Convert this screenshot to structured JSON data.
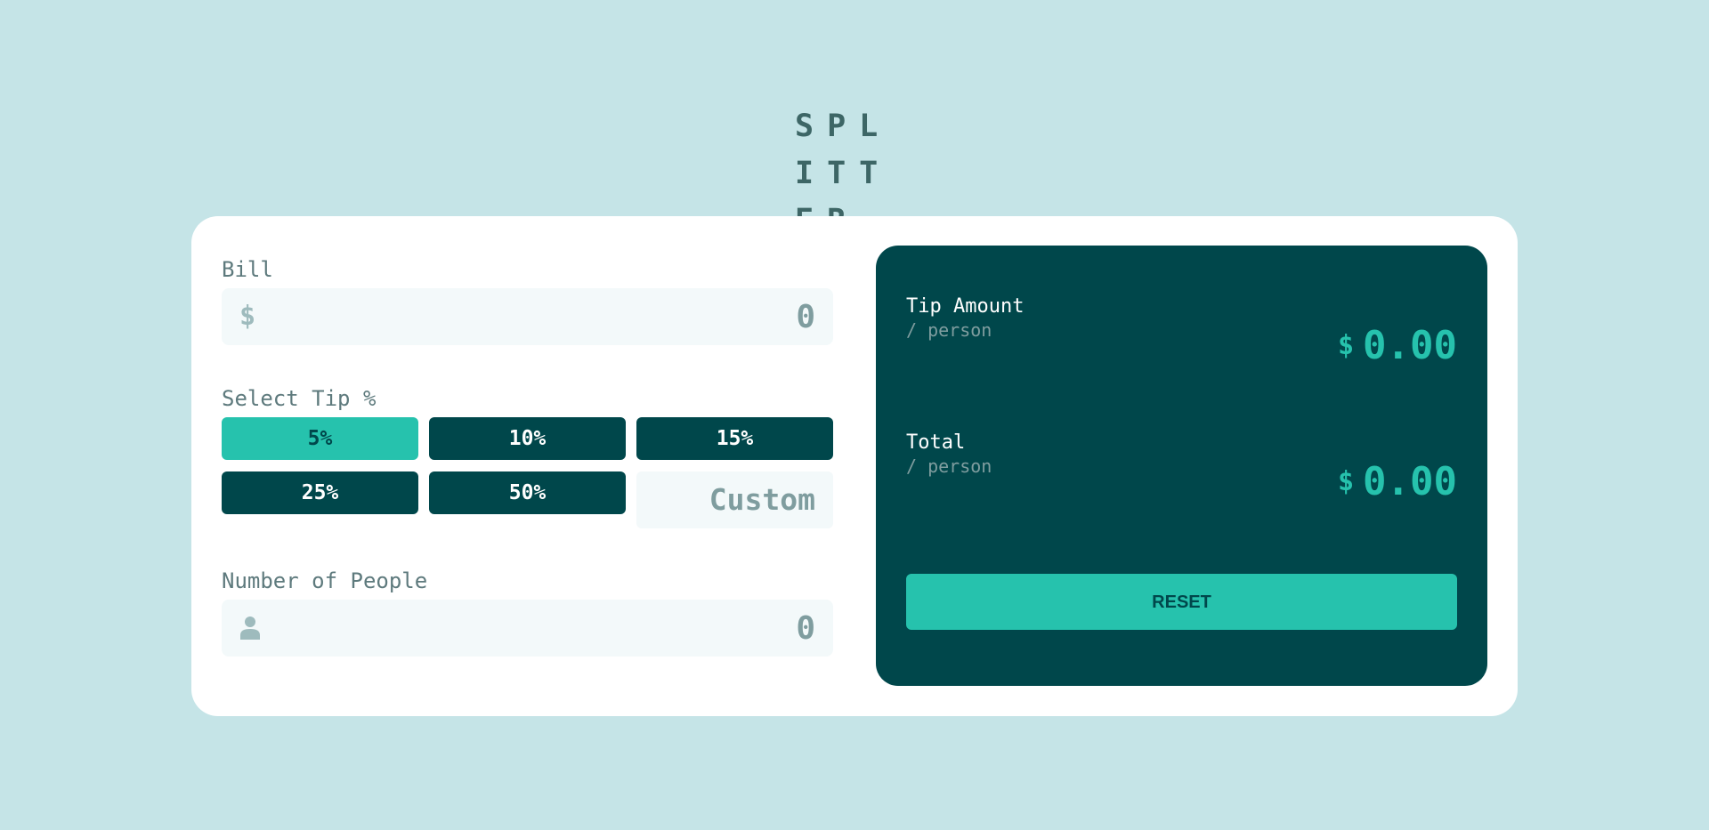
{
  "app": {
    "logo": "SPLITTER"
  },
  "bill": {
    "label": "Bill",
    "currency_symbol": "$",
    "value": "0"
  },
  "tip": {
    "label": "Select Tip %",
    "options": [
      "5%",
      "10%",
      "15%",
      "25%",
      "50%"
    ],
    "selected": "5%",
    "custom_placeholder": "Custom"
  },
  "people": {
    "label": "Number of People",
    "icon": "person-icon",
    "value": "0"
  },
  "results": {
    "tip_amount": {
      "title": "Tip Amount",
      "subtitle": "/ person",
      "currency": "$",
      "value": "0.00"
    },
    "total": {
      "title": "Total",
      "subtitle": "/ person",
      "currency": "$",
      "value": "0.00"
    },
    "reset_label": "RESET"
  },
  "colors": {
    "background": "#c5e4e7",
    "dark_cyan": "#00474b",
    "accent": "#26c2ad",
    "input_bg": "#f3f9fa",
    "label": "#5e7a7d"
  }
}
